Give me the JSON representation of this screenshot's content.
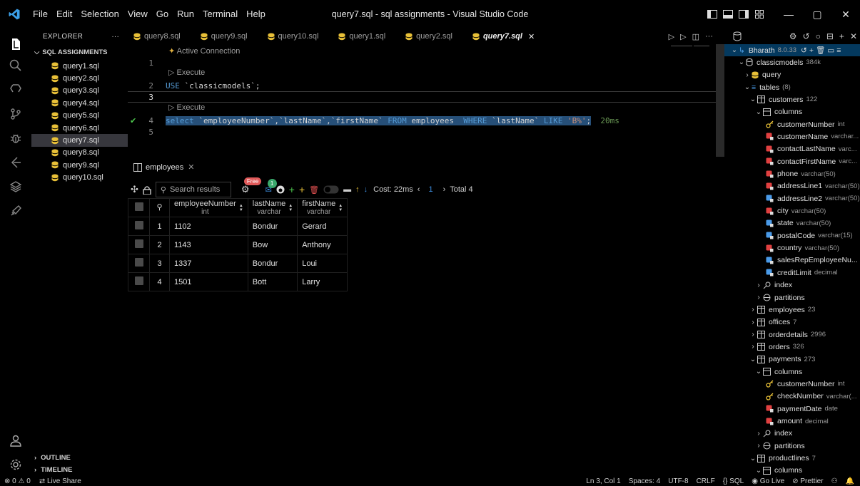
{
  "window": {
    "title": "query7.sql - sql assignments - Visual Studio Code",
    "menu": [
      "File",
      "Edit",
      "Selection",
      "View",
      "Go",
      "Run",
      "Terminal",
      "Help"
    ],
    "controls": {
      "minimize": "—",
      "restore": "▢",
      "close": "✕"
    }
  },
  "activity_bar": {
    "icons": [
      "files-icon",
      "search-icon",
      "source-control-icon",
      "extensions-icon",
      "debug-icon",
      "remote-icon",
      "database-icon",
      "deploy-icon",
      "account-icon",
      "settings-icon"
    ]
  },
  "explorer": {
    "header": "EXPLORER",
    "more": "···",
    "section": "SQL ASSIGNMENTS",
    "files": [
      "query1.sql",
      "query2.sql",
      "query3.sql",
      "query4.sql",
      "query5.sql",
      "query6.sql",
      "query7.sql",
      "query8.sql",
      "query9.sql",
      "query10.sql"
    ],
    "active_file": "query7.sql",
    "outline": "OUTLINE",
    "timeline": "TIMELINE"
  },
  "tabs": [
    {
      "label": "query8.sql"
    },
    {
      "label": "query9.sql"
    },
    {
      "label": "query10.sql"
    },
    {
      "label": "query1.sql"
    },
    {
      "label": "query2.sql"
    },
    {
      "label": "query7.sql",
      "active": true
    }
  ],
  "editor": {
    "active_connection": "Active Connection",
    "execute": "Execute",
    "lines": {
      "l1": "1",
      "l2": "2",
      "l3": "3",
      "l4": "4",
      "l5": "5"
    },
    "use_kw": "USE",
    "use_db": "`classicmodels`",
    "use_end": ";",
    "select_kw": "select",
    "select_cols": "`employeeNumber`,`lastName`,`firstName`",
    "from_kw": "FROM",
    "table": "employees",
    "where_kw": "WHERE",
    "where_col": "`lastName`",
    "like_kw": "LIKE",
    "like_val": "'B%'",
    "stmt_end": ";",
    "exec_time": "20ms",
    "more": "···"
  },
  "results": {
    "tab_label": "employees",
    "search_placeholder": "Search results",
    "free_badge": "Free",
    "notif_count": "1",
    "cost": "Cost: 22ms",
    "page": "1",
    "total": "Total 4",
    "columns": [
      {
        "name": "employeeNumber",
        "type": "int"
      },
      {
        "name": "lastName",
        "type": "varchar"
      },
      {
        "name": "firstName",
        "type": "varchar"
      }
    ],
    "rows": [
      {
        "n": "1",
        "employeeNumber": "1102",
        "lastName": "Bondur",
        "firstName": "Gerard"
      },
      {
        "n": "2",
        "employeeNumber": "1143",
        "lastName": "Bow",
        "firstName": "Anthony"
      },
      {
        "n": "3",
        "employeeNumber": "1337",
        "lastName": "Bondur",
        "firstName": "Loui"
      },
      {
        "n": "4",
        "employeeNumber": "1501",
        "lastName": "Bott",
        "firstName": "Larry"
      }
    ]
  },
  "db_panel": {
    "connection": "Bharath",
    "version": "8.0.33",
    "database": "classicmodels",
    "db_size": "384k",
    "query": "query",
    "tables": "tables",
    "tables_count": "(8)",
    "customers": "customers",
    "customers_count": "122",
    "columns": "columns",
    "customer_cols": [
      {
        "name": "customerNumber",
        "type": "int",
        "icon": "key"
      },
      {
        "name": "customerName",
        "type": "varchar...",
        "icon": "red"
      },
      {
        "name": "contactLastName",
        "type": "varc...",
        "icon": "red"
      },
      {
        "name": "contactFirstName",
        "type": "varc...",
        "icon": "red"
      },
      {
        "name": "phone",
        "type": "varchar(50)",
        "icon": "red"
      },
      {
        "name": "addressLine1",
        "type": "varchar(50)",
        "icon": "red"
      },
      {
        "name": "addressLine2",
        "type": "varchar(50)",
        "icon": "blue"
      },
      {
        "name": "city",
        "type": "varchar(50)",
        "icon": "red"
      },
      {
        "name": "state",
        "type": "varchar(50)",
        "icon": "blue"
      },
      {
        "name": "postalCode",
        "type": "varchar(15)",
        "icon": "blue"
      },
      {
        "name": "country",
        "type": "varchar(50)",
        "icon": "red"
      },
      {
        "name": "salesRepEmployeeNu...",
        "type": "",
        "icon": "blue"
      },
      {
        "name": "creditLimit",
        "type": "decimal",
        "icon": "blue"
      }
    ],
    "index": "index",
    "partitions": "partitions",
    "other_tables": [
      {
        "name": "employees",
        "count": "23"
      },
      {
        "name": "offices",
        "count": "7"
      },
      {
        "name": "orderdetails",
        "count": "2996"
      },
      {
        "name": "orders",
        "count": "326"
      }
    ],
    "payments": "payments",
    "payments_count": "273",
    "payment_cols": [
      {
        "name": "customerNumber",
        "type": "int",
        "icon": "key"
      },
      {
        "name": "checkNumber",
        "type": "varchar(...",
        "icon": "key"
      },
      {
        "name": "paymentDate",
        "type": "date",
        "icon": "red"
      },
      {
        "name": "amount",
        "type": "decimal",
        "icon": "red"
      }
    ],
    "productlines": "productlines",
    "productlines_count": "7"
  },
  "statusbar": {
    "problems": "⊗ 0 ⚠ 0",
    "live_share": "Live Share",
    "position": "Ln 3, Col 1",
    "spaces": "Spaces: 4",
    "encoding": "UTF-8",
    "eol": "CRLF",
    "language": "SQL",
    "go_live": "Go Live",
    "prettier": "Prettier"
  }
}
